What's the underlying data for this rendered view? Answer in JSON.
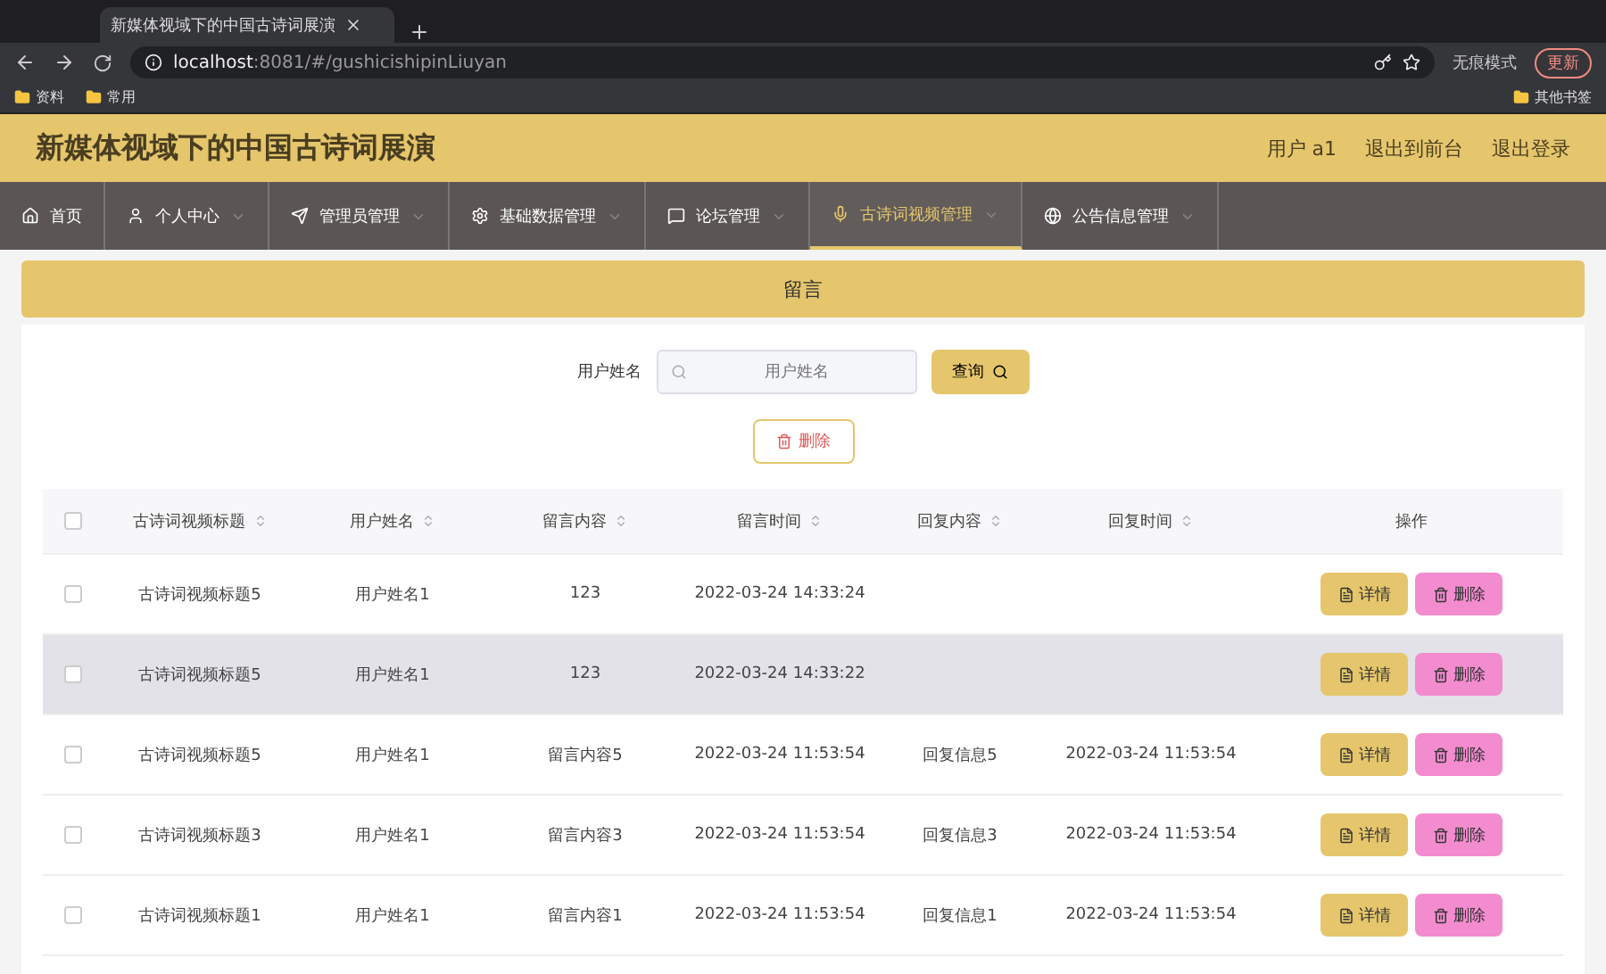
{
  "browser": {
    "tab_title": "新媒体视域下的中国古诗词展演",
    "url_host": "localhost",
    "url_rest": ":8081/#/gushicishipinLiuyan",
    "profile": "无痕模式",
    "update": "更新",
    "bookmarks": [
      "资料",
      "常用"
    ],
    "other_bookmarks": "其他书签"
  },
  "header": {
    "title": "新媒体视域下的中国古诗词展演",
    "user": "用户 a1",
    "links": [
      "退出到前台",
      "退出登录"
    ]
  },
  "nav": [
    {
      "label": "首页",
      "selected": false,
      "dropdown": false
    },
    {
      "label": "个人中心",
      "selected": false,
      "dropdown": true
    },
    {
      "label": "管理员管理",
      "selected": false,
      "dropdown": true
    },
    {
      "label": "基础数据管理",
      "selected": false,
      "dropdown": true
    },
    {
      "label": "论坛管理",
      "selected": false,
      "dropdown": true
    },
    {
      "label": "古诗词视频管理",
      "selected": true,
      "dropdown": true
    },
    {
      "label": "公告信息管理",
      "selected": false,
      "dropdown": true
    }
  ],
  "banner": {
    "title": "留言"
  },
  "search": {
    "label": "用户姓名",
    "placeholder": "用户姓名",
    "button": "查询"
  },
  "delete_button": "删除",
  "table": {
    "all_checked": false,
    "columns": [
      "古诗词视频标题",
      "用户姓名",
      "留言内容",
      "留言时间",
      "回复内容",
      "回复时间",
      "操作"
    ],
    "rows": [
      {
        "cells": [
          "古诗词视频标题5",
          "用户姓名1",
          "123",
          "2022-03-24 14:33:24",
          "",
          ""
        ],
        "actions": [
          "详情",
          "删除"
        ],
        "checked": false,
        "hovered": false
      },
      {
        "cells": [
          "古诗词视频标题5",
          "用户姓名1",
          "123",
          "2022-03-24 14:33:22",
          "",
          ""
        ],
        "actions": [
          "详情",
          "删除"
        ],
        "checked": false,
        "hovered": true
      },
      {
        "cells": [
          "古诗词视频标题5",
          "用户姓名1",
          "留言内容5",
          "2022-03-24 11:53:54",
          "回复信息5",
          "2022-03-24 11:53:54"
        ],
        "actions": [
          "详情",
          "删除"
        ],
        "checked": false,
        "hovered": false
      },
      {
        "cells": [
          "古诗词视频标题3",
          "用户姓名1",
          "留言内容3",
          "2022-03-24 11:53:54",
          "回复信息3",
          "2022-03-24 11:53:54"
        ],
        "actions": [
          "详情",
          "删除"
        ],
        "checked": false,
        "hovered": false
      },
      {
        "cells": [
          "古诗词视频标题1",
          "用户姓名1",
          "留言内容1",
          "2022-03-24 11:53:54",
          "回复信息1",
          "2022-03-24 11:53:54"
        ],
        "actions": [
          "详情",
          "删除"
        ],
        "checked": false,
        "hovered": false
      }
    ]
  }
}
